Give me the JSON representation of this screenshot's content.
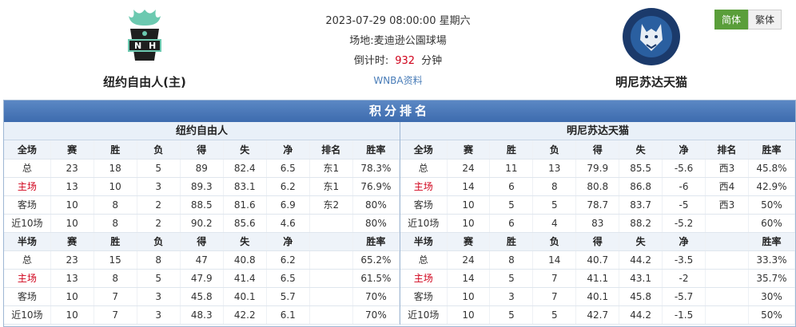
{
  "match": {
    "datetime": "2023-07-29 08:00:00 星期六",
    "venue_label": "场地:",
    "venue": "麦迪逊公園球場",
    "countdown_label": "倒计时:",
    "countdown_value": "932",
    "countdown_unit": "分钟",
    "league_link": "WNBA资料"
  },
  "home_team": {
    "name": "纽约自由人(主)",
    "logo_icon": "new-york-liberty-logo"
  },
  "away_team": {
    "name": "明尼苏达天猫",
    "logo_icon": "minnesota-lynx-logo"
  },
  "lang": {
    "simplified": "简体",
    "traditional": "繁体"
  },
  "standings": {
    "title": "积分排名",
    "home": {
      "name": "纽约自由人",
      "full_header": [
        "全场",
        "赛",
        "胜",
        "负",
        "得",
        "失",
        "净",
        "排名",
        "胜率"
      ],
      "full_rows": [
        [
          "总",
          "23",
          "18",
          "5",
          "89",
          "82.4",
          "6.5",
          "东1",
          "78.3%"
        ],
        [
          "主场",
          "13",
          "10",
          "3",
          "89.3",
          "83.1",
          "6.2",
          "东1",
          "76.9%"
        ],
        [
          "客场",
          "10",
          "8",
          "2",
          "88.5",
          "81.6",
          "6.9",
          "东2",
          "80%"
        ],
        [
          "近10场",
          "10",
          "8",
          "2",
          "90.2",
          "85.6",
          "4.6",
          "",
          "80%"
        ]
      ],
      "half_header": [
        "半场",
        "赛",
        "胜",
        "负",
        "得",
        "失",
        "净",
        "",
        "胜率"
      ],
      "half_rows": [
        [
          "总",
          "23",
          "15",
          "8",
          "47",
          "40.8",
          "6.2",
          "",
          "65.2%"
        ],
        [
          "主场",
          "13",
          "8",
          "5",
          "47.9",
          "41.4",
          "6.5",
          "",
          "61.5%"
        ],
        [
          "客场",
          "10",
          "7",
          "3",
          "45.8",
          "40.1",
          "5.7",
          "",
          "70%"
        ],
        [
          "近10场",
          "10",
          "7",
          "3",
          "48.3",
          "42.2",
          "6.1",
          "",
          "70%"
        ]
      ]
    },
    "away": {
      "name": "明尼苏达天猫",
      "full_header": [
        "全场",
        "赛",
        "胜",
        "负",
        "得",
        "失",
        "净",
        "排名",
        "胜率"
      ],
      "full_rows": [
        [
          "总",
          "24",
          "11",
          "13",
          "79.9",
          "85.5",
          "-5.6",
          "西3",
          "45.8%"
        ],
        [
          "主场",
          "14",
          "6",
          "8",
          "80.8",
          "86.8",
          "-6",
          "西4",
          "42.9%"
        ],
        [
          "客场",
          "10",
          "5",
          "5",
          "78.7",
          "83.7",
          "-5",
          "西3",
          "50%"
        ],
        [
          "近10场",
          "10",
          "6",
          "4",
          "83",
          "88.2",
          "-5.2",
          "",
          "60%"
        ]
      ],
      "half_header": [
        "半场",
        "赛",
        "胜",
        "负",
        "得",
        "失",
        "净",
        "",
        "胜率"
      ],
      "half_rows": [
        [
          "总",
          "24",
          "8",
          "14",
          "40.7",
          "44.2",
          "-3.5",
          "",
          "33.3%"
        ],
        [
          "主场",
          "14",
          "5",
          "7",
          "41.1",
          "43.1",
          "-2",
          "",
          "35.7%"
        ],
        [
          "客场",
          "10",
          "3",
          "7",
          "40.1",
          "45.8",
          "-5.7",
          "",
          "30%"
        ],
        [
          "近10场",
          "10",
          "5",
          "5",
          "42.7",
          "44.2",
          "-1.5",
          "",
          "50%"
        ]
      ]
    }
  },
  "colors": {
    "accent": "#3d6bae",
    "highlight_red": "#d0021b",
    "active_lang": "#5a9e3a"
  }
}
